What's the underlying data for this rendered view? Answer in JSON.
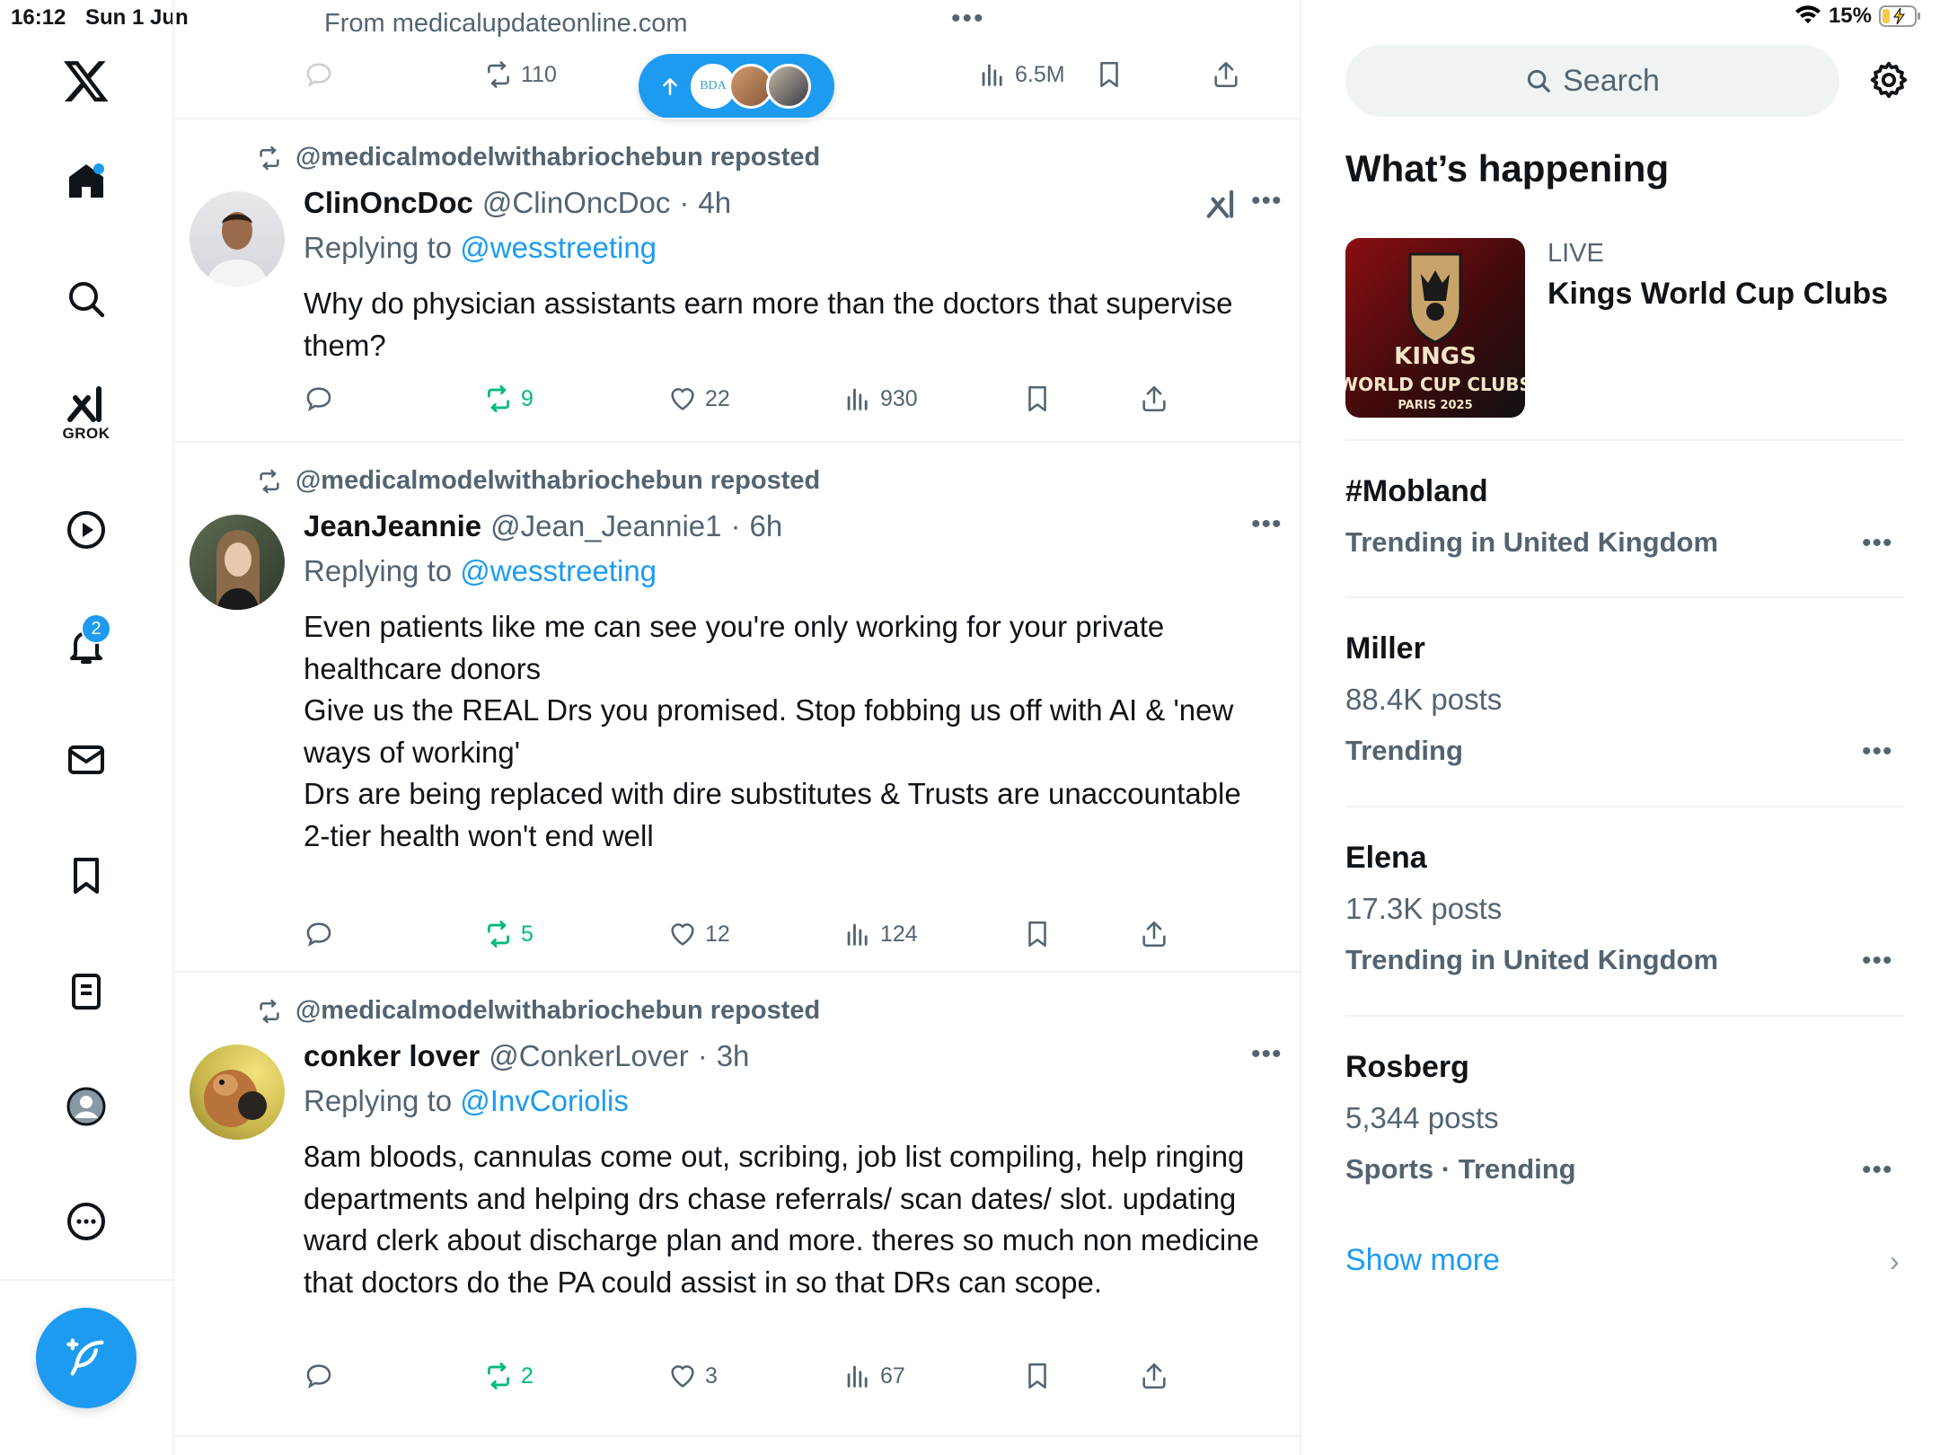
{
  "status": {
    "time": "16:12",
    "date": "Sun 1 Jun",
    "battery": "15%"
  },
  "feed": {
    "from_site": "From medicalupdateonline.com",
    "top_dots": "•••",
    "top_actions": {
      "retweets": "110",
      "views": "6.5M"
    },
    "pill": {
      "first_avatar": "BDA"
    },
    "posts": [
      {
        "reposted_by": "@medicalmodelwithabriochebun reposted",
        "name": "ClinOncDoc",
        "handle": "@ClinOncDoc",
        "time": "4h",
        "reply_prefix": "Replying to",
        "reply_to": "@wesstreeting",
        "text": "Why do physician assistants earn more than the doctors that supervise them?",
        "retweets": "9",
        "likes": "22",
        "views": "930"
      },
      {
        "reposted_by": "@medicalmodelwithabriochebun reposted",
        "name": "JeanJeannie",
        "handle": "@Jean_Jeannie1",
        "time": "6h",
        "reply_prefix": "Replying to",
        "reply_to": "@wesstreeting",
        "text": "Even patients like me can see you're only working for your private healthcare donors\nGive us the REAL Drs you promised. Stop fobbing us off with AI & 'new ways of working'\nDrs are being replaced with dire substitutes  & Trusts are unaccountable\n2-tier health won't end well",
        "retweets": "5",
        "likes": "12",
        "views": "124"
      },
      {
        "reposted_by": "@medicalmodelwithabriochebun reposted",
        "name": "conker lover",
        "handle": "@ConkerLover",
        "time": "3h",
        "reply_prefix": "Replying to",
        "reply_to": "@InvCoriolis",
        "text": "8am bloods, cannulas come out, scribing, job list compiling, help ringing departments and helping drs chase referrals/ scan dates/ slot. updating ward clerk about discharge plan and more. theres so much non medicine that doctors do the PA could assist in so that DRs can scope.",
        "retweets": "2",
        "likes": "3",
        "views": "67"
      }
    ]
  },
  "sidebar": {
    "grok_label": "GROK",
    "notifications_badge": "2"
  },
  "right": {
    "search_placeholder": "Search",
    "whats_happening": "What’s happening",
    "live_label": "LIVE",
    "live_title": "Kings World Cup Clubs",
    "live_image_text": {
      "line1": "KINGS",
      "line2": "WORLD CUP CLUBS",
      "line3": "PARIS 2025"
    },
    "trends": [
      {
        "title": "#Mobland",
        "posts": "",
        "meta": "Trending in United Kingdom"
      },
      {
        "title": "Miller",
        "posts": "88.4K posts",
        "meta": "Trending"
      },
      {
        "title": "Elena",
        "posts": "17.3K posts",
        "meta": "Trending in United Kingdom"
      },
      {
        "title": "Rosberg",
        "posts": "5,344 posts",
        "meta": "Sports · Trending"
      }
    ],
    "show_more": "Show more"
  },
  "colors": {
    "accent": "#1d9bf0",
    "retweet_green": "#00ba7c",
    "muted": "#536471"
  }
}
